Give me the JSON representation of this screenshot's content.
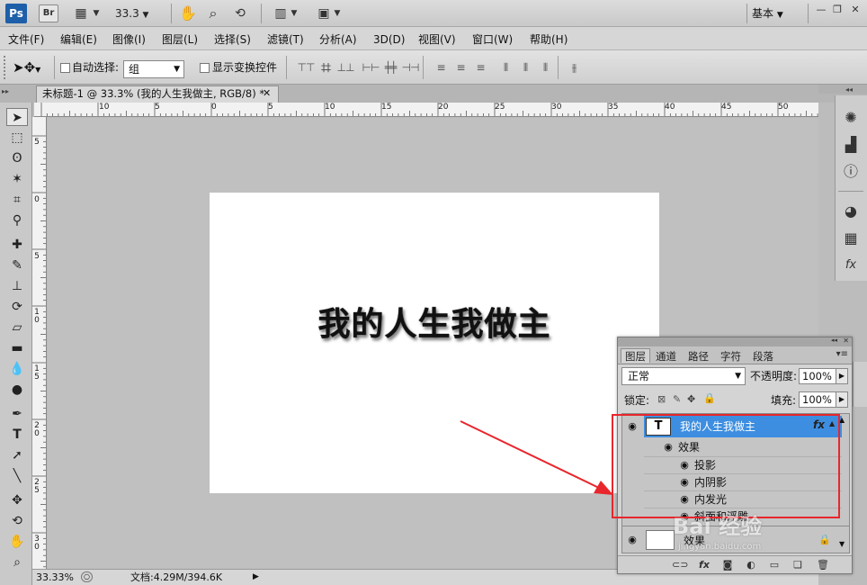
{
  "app": {
    "logo": "Ps",
    "bridge": "Br",
    "zoom": "33.3",
    "workspace": "基本"
  },
  "menu": [
    "文件(F)",
    "编辑(E)",
    "图像(I)",
    "图层(L)",
    "选择(S)",
    "滤镜(T)",
    "分析(A)",
    "3D(D)",
    "视图(V)",
    "窗口(W)",
    "帮助(H)"
  ],
  "options": {
    "auto_select_label": "自动选择:",
    "auto_select_value": "组",
    "show_transform_label": "显示变换控件"
  },
  "document": {
    "tab_title": "未标题-1 @ 33.3% (我的人生我做主, RGB/8) *",
    "canvas_text": "我的人生我做主"
  },
  "ruler": {
    "h_labels": [
      "10",
      "5",
      "0",
      "5",
      "10",
      "15",
      "20",
      "25",
      "30",
      "35",
      "40",
      "45",
      "50"
    ],
    "v_labels": [
      "5",
      "0",
      "5",
      "1\n0",
      "1\n5",
      "2\n0",
      "2\n5",
      "3\n0"
    ]
  },
  "status": {
    "zoom": "33.33%",
    "doc_info": "文档:4.29M/394.6K"
  },
  "layers_panel": {
    "tabs": [
      "图层",
      "通道",
      "路径",
      "字符",
      "段落"
    ],
    "blend_mode": "正常",
    "opacity_label": "不透明度:",
    "opacity_value": "100%",
    "lock_label": "锁定:",
    "fill_label": "填充:",
    "fill_value": "100%",
    "text_layer_name": "我的人生我做主",
    "text_layer_thumb": "T",
    "fx_badge": "fx",
    "effects_label": "效果",
    "effects": [
      "投影",
      "内阴影",
      "内发光",
      "斜面和浮雕"
    ],
    "bg_layer_name": "效果"
  },
  "watermark": {
    "main": "Bai 经验",
    "sub": "jingyan.baidu.com"
  },
  "colors": {
    "selected_layer": "#3d8ee0",
    "annotation": "#e8262c",
    "ps_blue": "#1e5fa9"
  }
}
